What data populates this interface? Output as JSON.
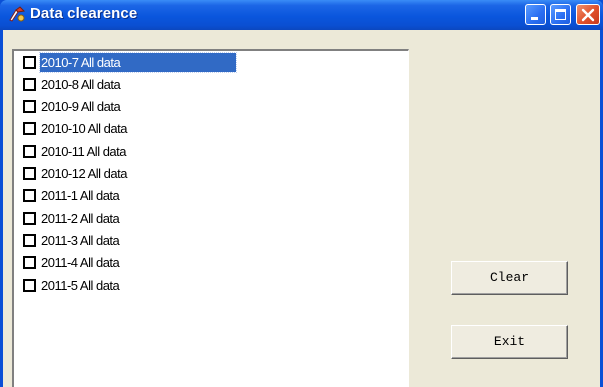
{
  "window": {
    "title": "Data clearence",
    "controls": [
      "minimize-icon",
      "maximize-icon",
      "close-icon"
    ]
  },
  "list": {
    "selected_index": 0,
    "items": [
      {
        "label": "2010-7 All data",
        "checked": false
      },
      {
        "label": "2010-8 All data",
        "checked": false
      },
      {
        "label": "2010-9 All data",
        "checked": false
      },
      {
        "label": "2010-10 All data",
        "checked": false
      },
      {
        "label": "2010-11 All data",
        "checked": false
      },
      {
        "label": "2010-12 All data",
        "checked": false
      },
      {
        "label": "2011-1 All data",
        "checked": false
      },
      {
        "label": "2011-2 All data",
        "checked": false
      },
      {
        "label": "2011-3 All data",
        "checked": false
      },
      {
        "label": "2011-4 All data",
        "checked": false
      },
      {
        "label": "2011-5 All data",
        "checked": false
      }
    ]
  },
  "buttons": {
    "clear_label": "Clear",
    "exit_label": "Exit"
  },
  "colors": {
    "titlebar": "#0a56dd",
    "selection": "#316ac5",
    "close_button": "#e0502a",
    "client_bg": "#ece9d8"
  }
}
